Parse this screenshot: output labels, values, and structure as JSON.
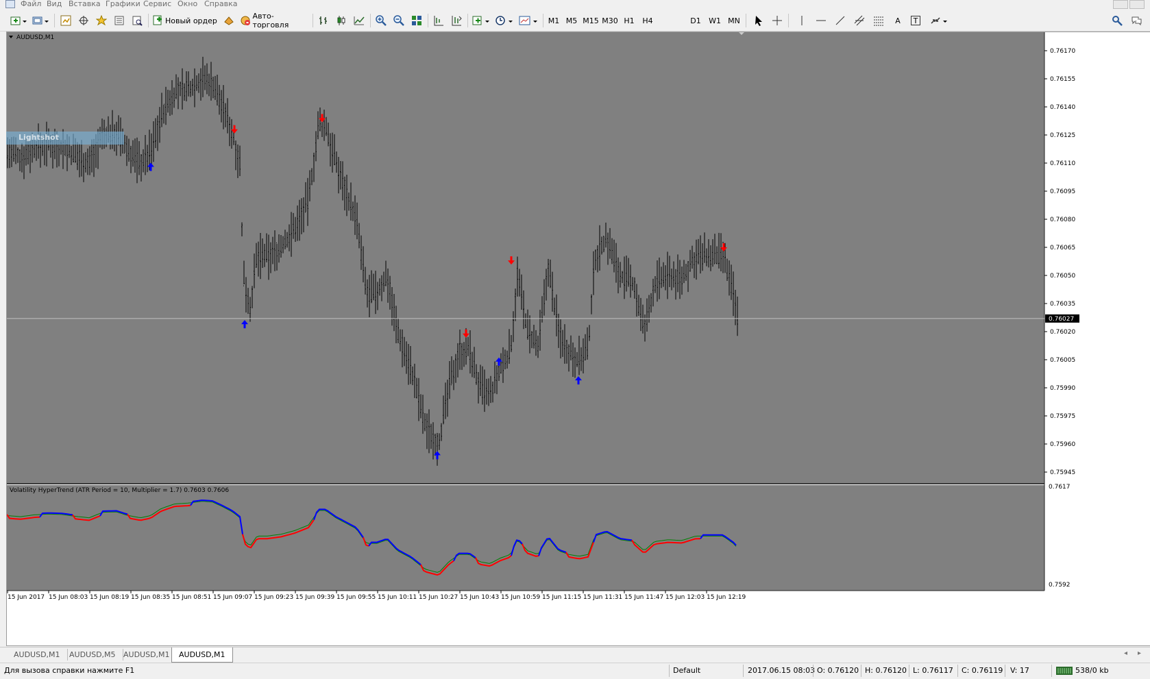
{
  "menu": [
    "Файл",
    "Вид",
    "Вставка",
    "Графики",
    "Сервис",
    "Окно",
    "Справка"
  ],
  "toolbar": {
    "new_order": "Новый ордер",
    "auto_trading": "Авто-торговля",
    "timeframes": [
      "M1",
      "M5",
      "M15",
      "M30",
      "H1",
      "H4",
      "D1",
      "W1",
      "MN"
    ],
    "text_tool": "A",
    "label_tool": "T"
  },
  "chart": {
    "symbol_label": "AUDUSD,M1",
    "indicator_label": "Volatility HyperTrend (ATR Period = 10, Multiplier = 1.7) 0.7603 0.7606",
    "price_axis": [
      "0.76170",
      "0.76155",
      "0.76140",
      "0.76125",
      "0.76110",
      "0.76095",
      "0.76080",
      "0.76065",
      "0.76050",
      "0.76035",
      "0.76020",
      "0.76005",
      "0.75990",
      "0.75975",
      "0.75960",
      "0.75945"
    ],
    "current_price": "0.76027",
    "indicator_axis": [
      "0.7617",
      "0.7592"
    ],
    "time_axis": [
      "15 Jun 2017",
      "15 Jun 08:03",
      "15 Jun 08:19",
      "15 Jun 08:35",
      "15 Jun 08:51",
      "15 Jun 09:07",
      "15 Jun 09:23",
      "15 Jun 09:39",
      "15 Jun 09:55",
      "15 Jun 10:11",
      "15 Jun 10:27",
      "15 Jun 10:43",
      "15 Jun 10:59",
      "15 Jun 11:15",
      "15 Jun 11:31",
      "15 Jun 11:47",
      "15 Jun 12:03",
      "15 Jun 12:19"
    ],
    "watermark": "Lightshot",
    "colors": {
      "background": "#808080",
      "bars": "#000000",
      "up_arrow": "#0000ff",
      "down_arrow": "#ff0000",
      "indicator_green": "#008000",
      "indicator_blue": "#0000ff",
      "indicator_red": "#ff0000",
      "price_line": "#c0c0c0"
    }
  },
  "tabs": [
    "AUDUSD,M1",
    "AUDUSD,M5",
    "AUDUSD,M1",
    "AUDUSD,M1"
  ],
  "active_tab": 3,
  "status": {
    "help": "Для вызова справки нажмите F1",
    "profile": "Default",
    "datetime": "2017.06.15 08:03",
    "open": "O: 0.76120",
    "high": "H: 0.76120",
    "low": "L: 0.76117",
    "close": "C: 0.76119",
    "volume": "V: 17",
    "traffic": "538/0 kb"
  }
}
